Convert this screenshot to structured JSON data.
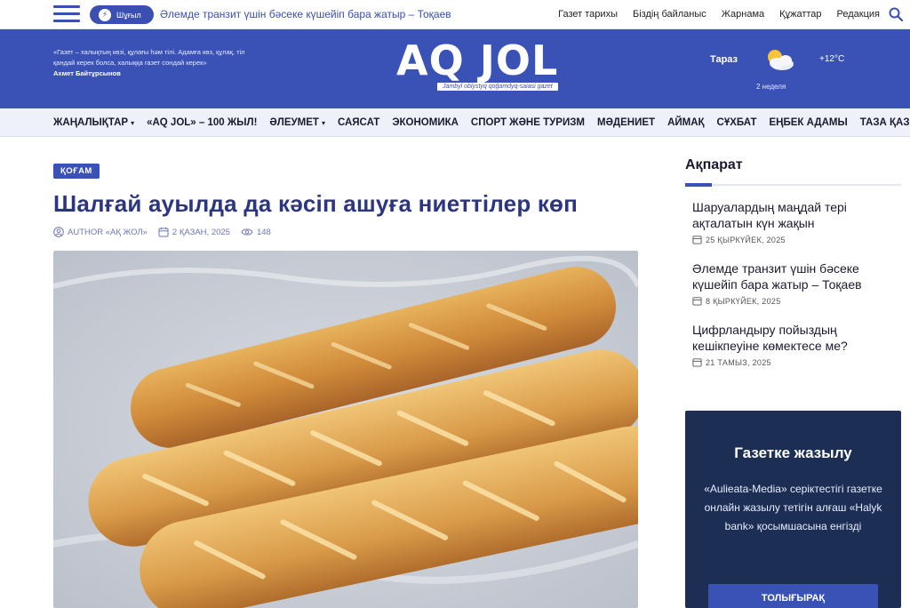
{
  "topbar": {
    "urgent_label": "Шұғыл",
    "ticker_text": "Әлемде транзит үшін бәсеке күшейіп бара жатыр – Тоқаев",
    "links": [
      "Газет тарихы",
      "Біздің байланыс",
      "Жарнама",
      "Құжаттар",
      "Редакция"
    ]
  },
  "header": {
    "quote_text": "«Газет – халықтың көзі, құлағы һәм тілі. Адамға көз, құлақ, тіл қандай керек болса, халыққа газет сондай керек»",
    "quote_author": "Ахмет Байтұрсынов",
    "logo_text": "AQ JOL",
    "logo_subtitle": "Jambyl oblystyq qoğamdyq-saiasi gazet",
    "weather_city": "Тараз",
    "weather_temp": "+12°C",
    "weather_day": "2 неделя",
    "weather_icon": "partly-cloudy-icon"
  },
  "nav": {
    "items": [
      {
        "label": "ЖАҢАЛЫҚТАР",
        "dropdown": true
      },
      {
        "label": "«AQ JOL» – 100 ЖЫЛ!",
        "dropdown": false
      },
      {
        "label": "ӘЛЕУМЕТ",
        "dropdown": true
      },
      {
        "label": "САЯСАТ",
        "dropdown": false
      },
      {
        "label": "ЭКОНОМИКА",
        "dropdown": false
      },
      {
        "label": "СПОРТ ЖӘНЕ ТУРИЗМ",
        "dropdown": false
      },
      {
        "label": "МӘДЕНИЕТ",
        "dropdown": false
      },
      {
        "label": "АЙМАҚ",
        "dropdown": false
      },
      {
        "label": "СҰХБАТ",
        "dropdown": false
      },
      {
        "label": "ЕҢБЕК АДАМЫ",
        "dropdown": false
      },
      {
        "label": "ТАЗА ҚАЗАҚСТАН",
        "dropdown": false
      }
    ]
  },
  "article": {
    "category": "ҚОҒАМ",
    "title": "Шалғай ауылда да кәсіп ашуға ниеттілер көп",
    "author": "AUTHOR «АҚ ЖОЛ»",
    "date": "2 ҚАЗАН, 2025",
    "views": "148"
  },
  "sidebar": {
    "title": "Ақпарат",
    "news": [
      {
        "title": "Шаруалардың маңдай тері ақталатын күн жақын",
        "date": "25 ҚЫРКҮЙЕК, 2025"
      },
      {
        "title": "Әлемде транзит үшін бәсеке күшейіп бара жатыр – Тоқаев",
        "date": "8 ҚЫРКҮЙЕК, 2025"
      },
      {
        "title": "Цифрландыру пойыздың кешікпеуіне көмектесе ме?",
        "date": "21 ТАМЫЗ, 2025"
      }
    ],
    "subscribe": {
      "title": "Газетке жазылу",
      "text": "«Aulieata-Media» серіктестігі газетке онлайн жазылу тетігін алғаш «Halyk bank» қосымшасына енгізді",
      "button": "ТОЛЫҒЫРАҚ"
    }
  },
  "colors": {
    "brand": "#3a52b5",
    "title": "#2c3580",
    "subscribe_bg": "#1c2e54"
  }
}
